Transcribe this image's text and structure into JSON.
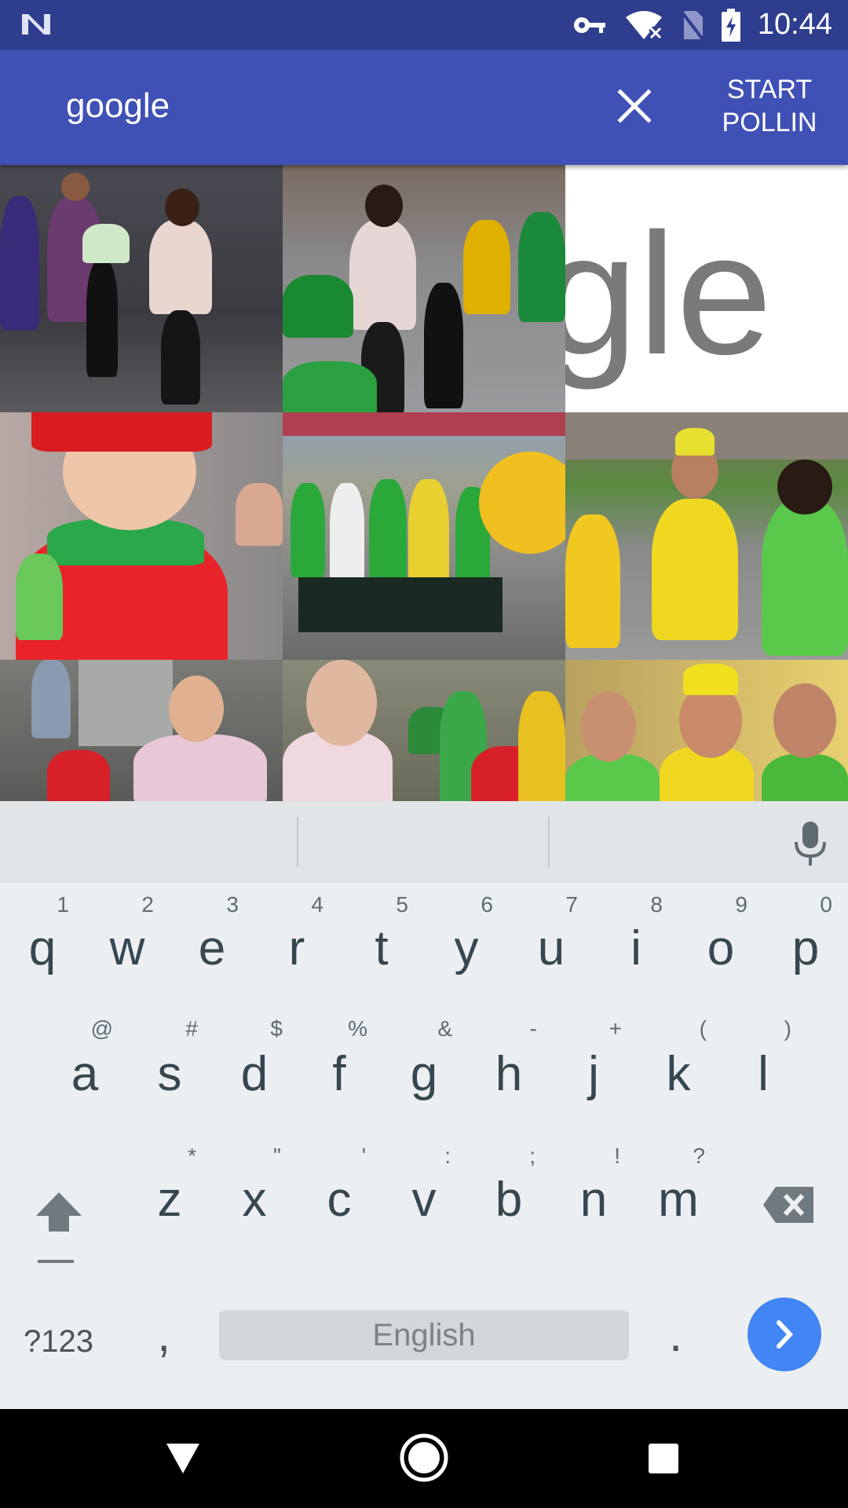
{
  "status_bar": {
    "time": "10:44"
  },
  "app_bar": {
    "search_value": "google",
    "action_line1": "START",
    "action_line2": "POLLIN"
  },
  "keyboard": {
    "row1": [
      {
        "key": "q",
        "hint": "1"
      },
      {
        "key": "w",
        "hint": "2"
      },
      {
        "key": "e",
        "hint": "3"
      },
      {
        "key": "r",
        "hint": "4"
      },
      {
        "key": "t",
        "hint": "5"
      },
      {
        "key": "y",
        "hint": "6"
      },
      {
        "key": "u",
        "hint": "7"
      },
      {
        "key": "i",
        "hint": "8"
      },
      {
        "key": "o",
        "hint": "9"
      },
      {
        "key": "p",
        "hint": "0"
      }
    ],
    "row2": [
      {
        "key": "a",
        "hint": "@"
      },
      {
        "key": "s",
        "hint": "#"
      },
      {
        "key": "d",
        "hint": "$"
      },
      {
        "key": "f",
        "hint": "%"
      },
      {
        "key": "g",
        "hint": "&"
      },
      {
        "key": "h",
        "hint": "-"
      },
      {
        "key": "j",
        "hint": "+"
      },
      {
        "key": "k",
        "hint": "("
      },
      {
        "key": "l",
        "hint": ")"
      }
    ],
    "row3": [
      {
        "key": "z",
        "hint": "*"
      },
      {
        "key": "x",
        "hint": "\""
      },
      {
        "key": "c",
        "hint": "'"
      },
      {
        "key": "v",
        "hint": ":"
      },
      {
        "key": "b",
        "hint": ";"
      },
      {
        "key": "n",
        "hint": "!"
      },
      {
        "key": "m",
        "hint": "?"
      }
    ],
    "symbols_label": "?123",
    "comma": ",",
    "period": ".",
    "space_label": "English"
  },
  "colors": {
    "app_bar": "#3f51b5",
    "status_bar": "#2f3d8f",
    "go_button": "#4285f4"
  }
}
